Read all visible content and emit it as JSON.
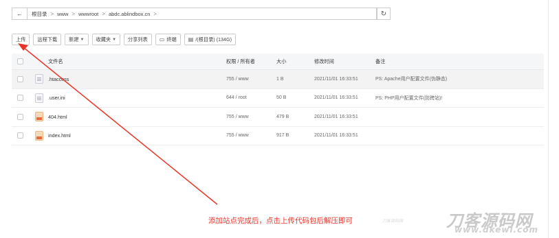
{
  "pathbar": {
    "back_icon": "←",
    "crumbs": [
      "根目录",
      "www",
      "wwwroot",
      "abdc.ablindbox.cn"
    ],
    "separator": ">",
    "refresh_icon": "↻"
  },
  "toolbar": {
    "upload": "上传",
    "remote_download": "远程下载",
    "new": "新建",
    "favorites": "收藏夹",
    "share_list": "分享列表",
    "terminal": "终端",
    "disk": "/(根目录) (134G)"
  },
  "table": {
    "headers": {
      "name": "文件名",
      "perm": "权限 / 所有者",
      "size": "大小",
      "mtime": "修改时间",
      "note": "备注"
    },
    "rows": [
      {
        "name": ".htaccess",
        "perm": "755 / www",
        "size": "1 B",
        "mtime": "2021/11/01 16:33:51",
        "note": "PS: Apache用户配置文件(伪静态)",
        "icon": "text-file-icon"
      },
      {
        "name": ".user.ini",
        "perm": "644 / root",
        "size": "50 B",
        "mtime": "2021/11/01 16:33:51",
        "note": "PS: PHP用户配置文件(防跨站)!",
        "icon": "text-file-icon"
      },
      {
        "name": "404.html",
        "perm": "755 / www",
        "size": "479 B",
        "mtime": "2021/11/01 16:33:51",
        "note": "",
        "icon": "html-file-icon"
      },
      {
        "name": "index.html",
        "perm": "755 / www",
        "size": "917 B",
        "mtime": "2021/11/01 16:33:51",
        "note": "",
        "icon": "html-file-icon"
      }
    ]
  },
  "annotation": {
    "text": "添加站点完成后，点击上传代码包后解压即可",
    "color": "#e8352a"
  },
  "watermark": {
    "brand": "刀客源码网",
    "url": "www.dkewl.com",
    "small": "刀客源码网"
  }
}
